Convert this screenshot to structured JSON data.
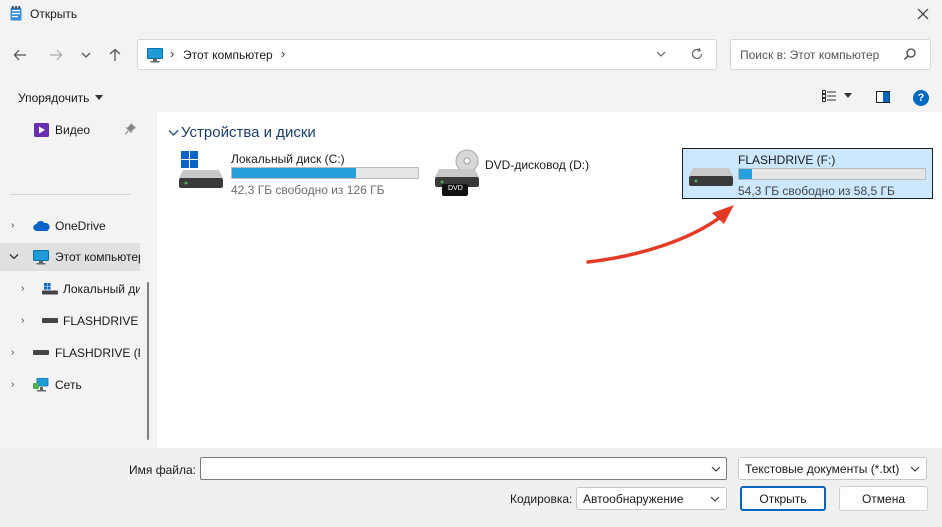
{
  "window": {
    "title": "Открыть"
  },
  "address": {
    "crumb": "Этот компьютер"
  },
  "search": {
    "placeholder": "Поиск в: Этот компьютер"
  },
  "toolbar": {
    "organize": "Упорядочить"
  },
  "nav": {
    "items": [
      {
        "label": "Видео",
        "icon": "video-icon"
      },
      {
        "label": "OneDrive",
        "icon": "onedrive-icon"
      },
      {
        "label": "Этот компьютер",
        "icon": "pc-icon"
      },
      {
        "label": "Локальный диск (C:)",
        "icon": "windows-drive-icon"
      },
      {
        "label": "FLASHDRIVE (F:)",
        "icon": "usb-drive-icon"
      },
      {
        "label": "FLASHDRIVE (F:)",
        "icon": "usb-drive-icon"
      },
      {
        "label": "Сеть",
        "icon": "network-icon"
      }
    ]
  },
  "content": {
    "group_title": "Устройства и диски",
    "drives": [
      {
        "name": "Локальный диск (C:)",
        "free_text": "42,3 ГБ свободно из 126 ГБ",
        "used_fraction": 0.664,
        "icon": "windows-drive-icon"
      },
      {
        "name": "DVD-дисковод (D:)",
        "badge": "DVD",
        "icon": "dvd-drive-icon"
      },
      {
        "name": "FLASHDRIVE (F:)",
        "free_text": "54,3 ГБ свободно из 58,5 ГБ",
        "used_fraction": 0.072,
        "icon": "usb-drive-icon"
      }
    ]
  },
  "footer": {
    "filename_label": "Имя файла:",
    "filename_value": "",
    "filetype_value": "Текстовые документы (*.txt)",
    "encoding_label": "Кодировка:",
    "encoding_value": "Автообнаружение",
    "open_label": "Открыть",
    "cancel_label": "Отмена"
  },
  "colors": {
    "accent": "#0067c0",
    "bar_fill": "#26a0da",
    "selection": "#cce8ff",
    "annotation_arrow": "#e53a24"
  }
}
